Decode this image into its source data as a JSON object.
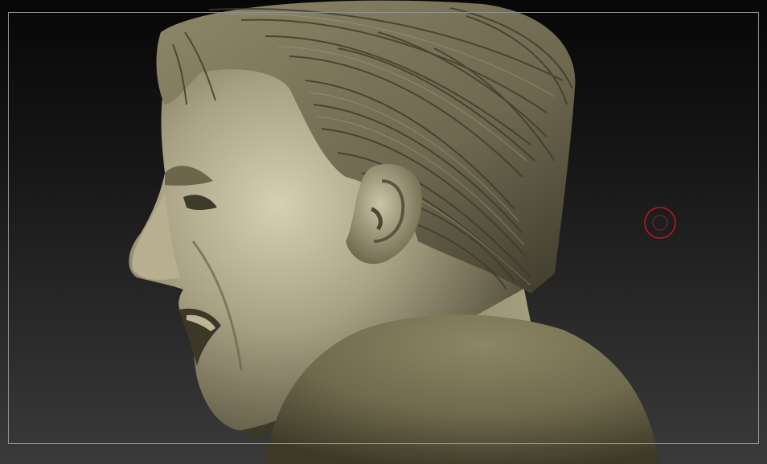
{
  "viewport": {
    "background_top": "#070707",
    "background_bottom": "#3a3a3a",
    "frame_color": "#8f8f8f"
  },
  "model": {
    "material_color": "#9a9378",
    "shadow_color": "#4a4634",
    "highlight_color": "#cfc8aa",
    "hair_color": "#7d7659"
  },
  "cursor": {
    "icon": "brush-cursor-icon",
    "color": "#c8141e"
  }
}
